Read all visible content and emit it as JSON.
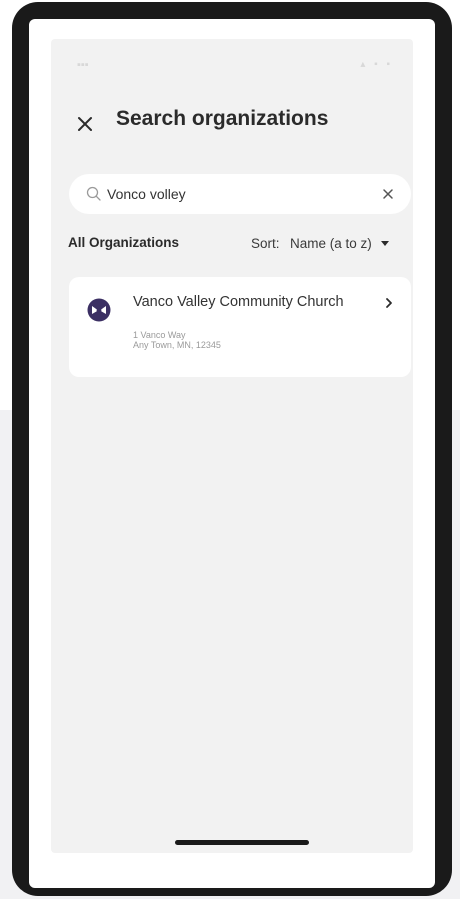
{
  "header": {
    "title": "Search organizations"
  },
  "search": {
    "value": "Vonco volley"
  },
  "list": {
    "section_title": "All Organizations",
    "sort_label": "Sort:",
    "sort_value": "Name (a to z)"
  },
  "organizations": [
    {
      "name": "Vanco Valley Community Church",
      "address_line1": "1 Vanco Way",
      "address_line2": "Any Town, MN, 12345"
    }
  ],
  "icons": {
    "close": "close-icon",
    "search": "search-icon",
    "clear": "clear-icon",
    "sort_caret": "caret-down-icon",
    "org_logo": "organization-logo",
    "chevron": "chevron-right-icon"
  },
  "colors": {
    "app_background": "#f2f2f2",
    "card_background": "#ffffff",
    "logo_purple": "#3b2f63",
    "device_frame": "#1a1a1a"
  }
}
